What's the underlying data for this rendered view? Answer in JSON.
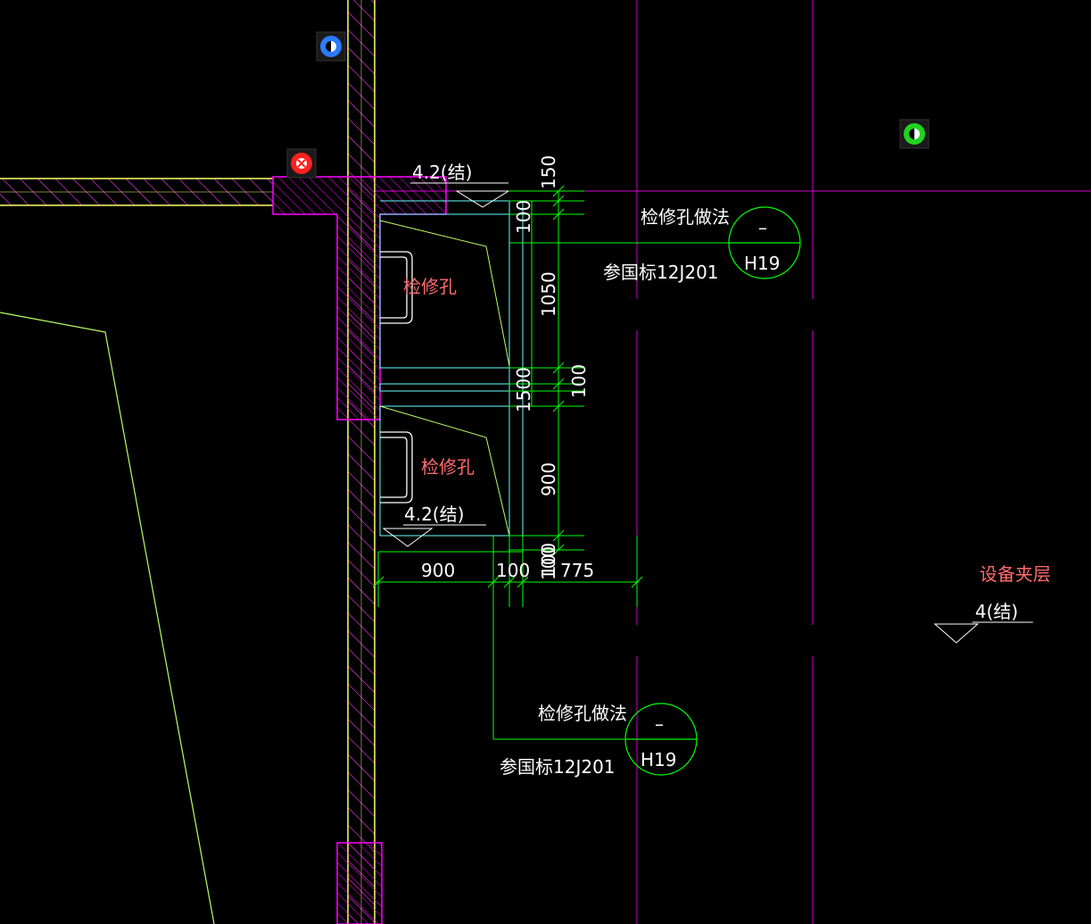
{
  "colors": {
    "background": "#000000",
    "magenta": "#ff00ff",
    "yellow": "#ffff66",
    "green": "#00ff00",
    "cyan": "#66ffff",
    "white": "#ffffff",
    "label_red": "#ff6b6b"
  },
  "elevation_top": "4.2(结)",
  "elevation_mid": "4.2(结)",
  "elevation_right": "4(结)",
  "room_label": "设备夹层",
  "hatch_labels": [
    "检修孔",
    "检修孔"
  ],
  "callouts": [
    {
      "title": "检修孔做法",
      "ref": "参国标12J201",
      "circle_top": "–",
      "circle_bottom": "H19"
    },
    {
      "title": "检修孔做法",
      "ref": "参国标12J201",
      "circle_top": "–",
      "circle_bottom": "H19"
    }
  ],
  "dims_vertical": [
    "150",
    "100",
    "1050",
    "100",
    "1500",
    "900",
    "100"
  ],
  "dims_horizontal": [
    "900",
    "100",
    "100",
    "775"
  ],
  "osnap_icons": [
    {
      "name": "blue-snap-icon",
      "color": "#2b7bff"
    },
    {
      "name": "red-snap-icon",
      "color": "#ff2020"
    },
    {
      "name": "green-snap-icon",
      "color": "#1fd31f"
    }
  ]
}
